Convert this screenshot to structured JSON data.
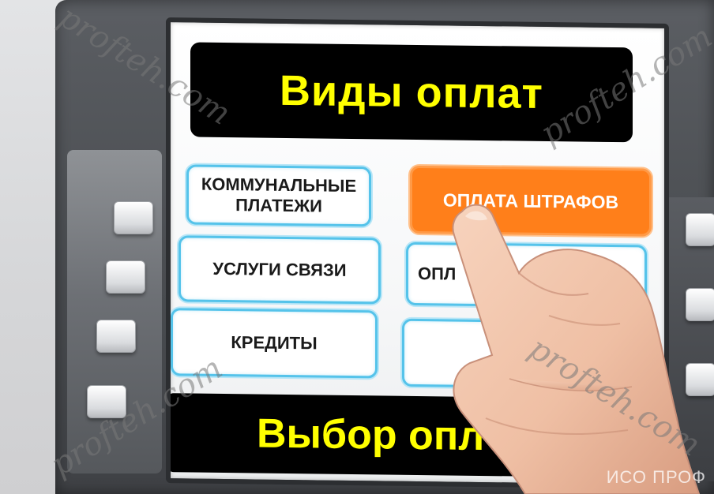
{
  "screen": {
    "title": "Виды оплат",
    "footer": "Выбор опл"
  },
  "buttons": {
    "utilities": "КОММУНАЛЬНЫЕ ПЛАТЕЖИ",
    "fines": "ОПЛАТА ШТРАФОВ",
    "communication": "УСЛУГИ СВЯЗИ",
    "partial_right": "ОПЛ",
    "credits": "КРЕДИТЫ",
    "empty_right": ""
  },
  "watermark": {
    "text": "profteh.com",
    "corner": "ИСО ПРОФ"
  },
  "colors": {
    "title_text": "#ffff00",
    "accent_button": "#ff7f1a",
    "button_border": "#55c3ea"
  }
}
